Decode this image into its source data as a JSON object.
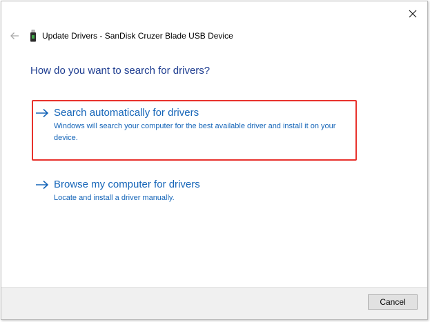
{
  "window": {
    "title": "Update Drivers - SanDisk Cruzer Blade USB Device",
    "close_icon": "close-icon",
    "back_icon": "back-arrow-icon",
    "device_icon": "usb-drive-icon"
  },
  "main": {
    "heading": "How do you want to search for drivers?",
    "options": [
      {
        "title": "Search automatically for drivers",
        "description": "Windows will search your computer for the best available driver and install it on your device.",
        "icon": "arrow-right-icon",
        "highlighted": true
      },
      {
        "title": "Browse my computer for drivers",
        "description": "Locate and install a driver manually.",
        "icon": "arrow-right-icon",
        "highlighted": false
      }
    ]
  },
  "footer": {
    "cancel_label": "Cancel"
  },
  "colors": {
    "link": "#1565b8",
    "heading": "#1c3b8f",
    "highlight_border": "#e8322c",
    "footer_bg": "#f0f0f0"
  }
}
